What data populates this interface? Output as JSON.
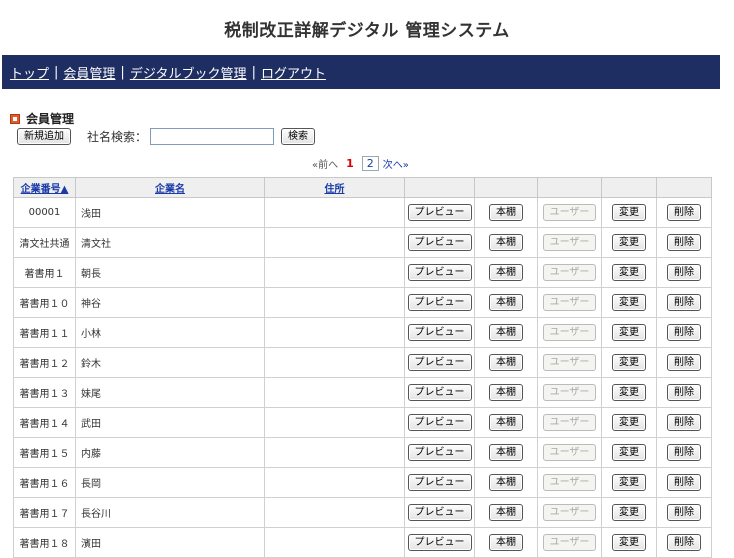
{
  "app_title": "税制改正詳解デジタル 管理システム",
  "nav": {
    "items": [
      "トップ",
      "会員管理",
      "デジタルブック管理",
      "ログアウト"
    ],
    "separator": "|"
  },
  "section": {
    "title": "会員管理"
  },
  "toolbar": {
    "new_button": "新規追加",
    "search_label": "社名検索：",
    "search_value": "",
    "search_button": "検索"
  },
  "pagination": {
    "prev": "«前へ",
    "current": "1",
    "page2": "2",
    "next": "次へ»"
  },
  "table": {
    "headers": {
      "number": "企業番号▲",
      "name": "企業名",
      "address": "住所"
    },
    "button_labels": {
      "preview": "プレビュー",
      "bookshelf": "本棚",
      "user": "ユーザー",
      "edit": "変更",
      "delete": "削除"
    },
    "rows": [
      {
        "number": "00001",
        "name": "浅田",
        "address": ""
      },
      {
        "number": "清文社共通",
        "name": "清文社",
        "address": ""
      },
      {
        "number": "著書用１",
        "name": "朝長",
        "address": ""
      },
      {
        "number": "著書用１０",
        "name": "神谷",
        "address": ""
      },
      {
        "number": "著書用１１",
        "name": "小林",
        "address": ""
      },
      {
        "number": "著書用１２",
        "name": "鈴木",
        "address": ""
      },
      {
        "number": "著書用１３",
        "name": "妹尾",
        "address": ""
      },
      {
        "number": "著書用１４",
        "name": "武田",
        "address": ""
      },
      {
        "number": "著書用１５",
        "name": "内藤",
        "address": ""
      },
      {
        "number": "著書用１６",
        "name": "長岡",
        "address": ""
      },
      {
        "number": "著書用１７",
        "name": "長谷川",
        "address": ""
      },
      {
        "number": "著書用１８",
        "name": "濱田",
        "address": ""
      }
    ]
  },
  "colors": {
    "navbar_bg": "#1e2d62",
    "link": "#1a3aa8",
    "current_page": "#dd0000",
    "section_icon": "#e05a2b"
  },
  "icons": [
    "section-bullet-icon"
  ]
}
